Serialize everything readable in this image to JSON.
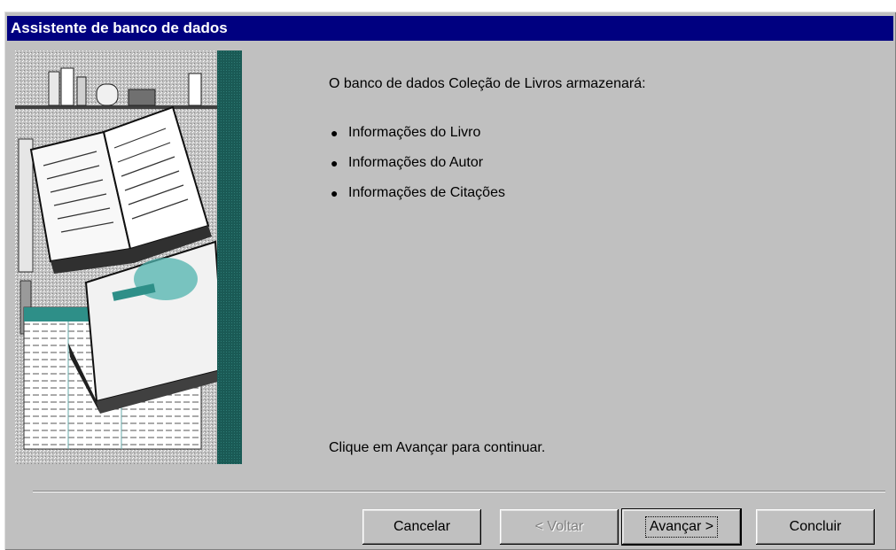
{
  "window": {
    "title": "Assistente de banco de dados"
  },
  "content": {
    "intro": "O banco de dados Coleção de Livros armazenará:",
    "items": [
      "Informações do Livro",
      "Informações do Autor",
      "Informações de Citações"
    ],
    "hint": "Clique em Avançar para continuar."
  },
  "buttons": {
    "cancel": "Cancelar",
    "back": "< Voltar",
    "next": "Avançar >",
    "finish": "Concluir"
  },
  "colors": {
    "titlebar": "#000080",
    "dialog_bg": "#c0c0c0",
    "accent_teal": "#1a5a55"
  },
  "icons": {
    "illustration": "books-illustration"
  }
}
